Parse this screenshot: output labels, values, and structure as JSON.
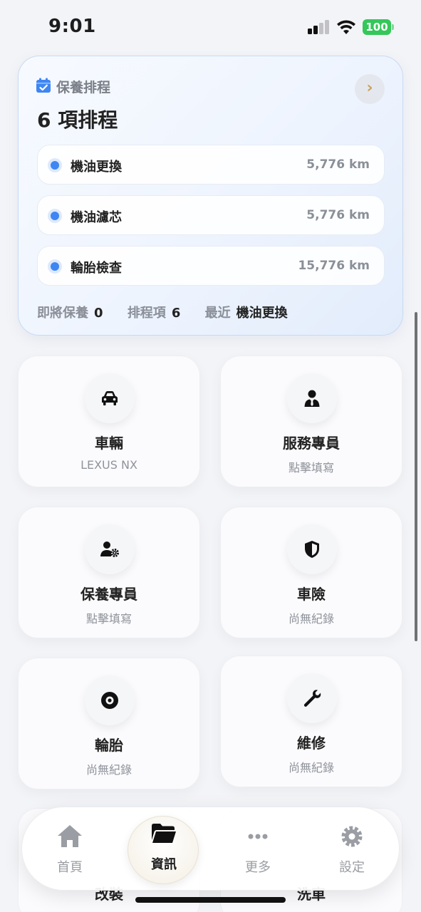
{
  "status_bar": {
    "time": "9:01",
    "battery": "100"
  },
  "schedule": {
    "label": "保養排程",
    "title": "6 項排程",
    "items": [
      {
        "name": "機油更換",
        "distance": "5,776 km"
      },
      {
        "name": "機油濾芯",
        "distance": "5,776 km"
      },
      {
        "name": "輪胎檢查",
        "distance": "15,776 km"
      }
    ],
    "stats": {
      "upcoming_label": "即將保養",
      "upcoming_value": "0",
      "count_label": "排程項",
      "count_value": "6",
      "latest_label": "最近",
      "latest_value": "機油更換"
    },
    "more_icon": "chevron-right-icon"
  },
  "tiles": [
    {
      "title": "車輛",
      "subtitle": "LEXUS NX",
      "icon": "car-icon"
    },
    {
      "title": "服務專員",
      "subtitle": "點擊填寫",
      "icon": "agent-icon"
    },
    {
      "title": "保養專員",
      "subtitle": "點擊填寫",
      "icon": "user-gear-icon"
    },
    {
      "title": "車險",
      "subtitle": "尚無紀錄",
      "icon": "shield-icon"
    },
    {
      "title": "輪胎",
      "subtitle": "尚無紀錄",
      "icon": "tire-icon"
    },
    {
      "title": "維修",
      "subtitle": "尚無紀錄",
      "icon": "wrench-icon"
    }
  ],
  "peek_tiles": [
    {
      "title": "改裝"
    },
    {
      "title": "洗車"
    }
  ],
  "tabbar": {
    "tabs": [
      {
        "label": "首頁",
        "icon": "home-icon",
        "active": false
      },
      {
        "label": "資訊",
        "icon": "folder-icon",
        "active": true
      },
      {
        "label": "更多",
        "icon": "more-icon",
        "active": false
      },
      {
        "label": "設定",
        "icon": "settings-icon",
        "active": false
      }
    ]
  },
  "colors": {
    "accent": "#3e86f3",
    "battery": "#34c759",
    "card_border": "#c9daf2"
  }
}
